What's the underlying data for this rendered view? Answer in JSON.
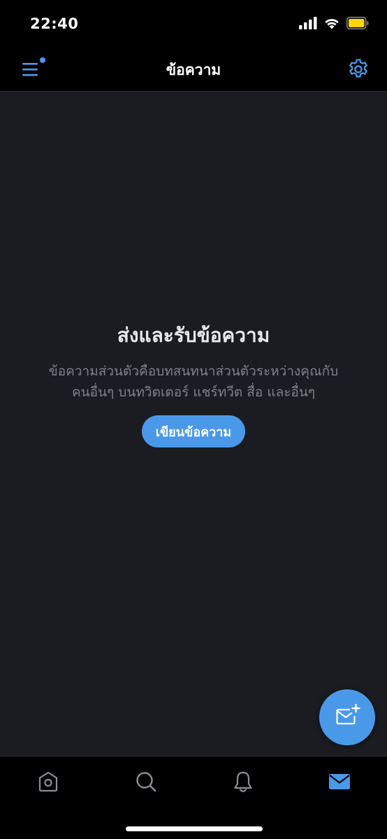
{
  "status_bar": {
    "time": "22:40"
  },
  "header": {
    "title": "ข้อความ",
    "menu_icon": "menu-icon",
    "settings_icon": "gear-icon"
  },
  "empty_state": {
    "title": "ส่งและรับข้อความ",
    "description_line1": "ข้อความส่วนตัวคือบทสนทนาส่วนตัวระหว่างคุณกับ",
    "description_line2": "คนอื่นๆ บนทวิตเตอร์ แชร์ทวีต สื่อ และอื่นๆ",
    "button_label": "เขียนข้อความ"
  },
  "fab": {
    "icon": "new-message-icon"
  },
  "tab_bar": {
    "items": [
      {
        "icon": "home-icon",
        "active": false
      },
      {
        "icon": "search-icon",
        "active": false
      },
      {
        "icon": "bell-icon",
        "active": false
      },
      {
        "icon": "mail-icon",
        "active": true
      }
    ]
  },
  "colors": {
    "accent": "#4a99e9",
    "background": "#1b1c21",
    "bar_background": "#000000",
    "muted_text": "#7d8188",
    "inactive_icon": "#8b8f96"
  }
}
